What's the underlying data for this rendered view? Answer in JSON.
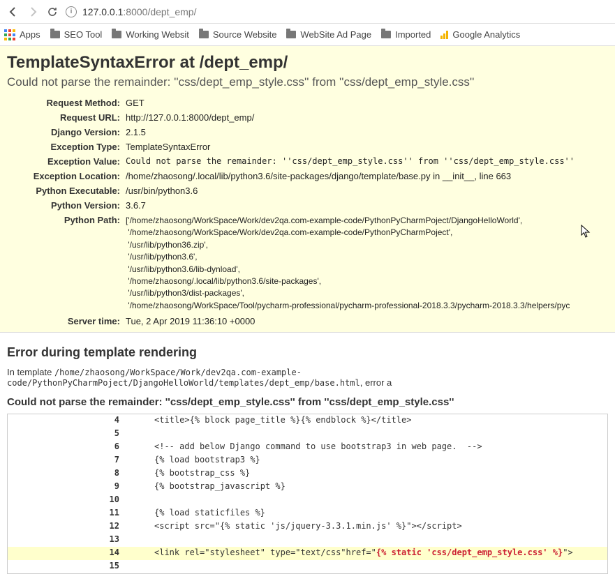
{
  "browser": {
    "url_host": "127.0.0.1",
    "url_port": ":8000",
    "url_path": "/dept_emp/",
    "bookmarks": [
      "Apps",
      "SEO Tool",
      "Working Websit",
      "Source Website",
      "WebSite Ad Page",
      "Imported",
      "Google Analytics"
    ]
  },
  "error": {
    "title": "TemplateSyntaxError at /dept_emp/",
    "subtitle": "Could not parse the remainder: ''css/dept_emp_style.css'' from ''css/dept_emp_style.css''",
    "kv": {
      "Request Method:": "GET",
      "Request URL:": "http://127.0.0.1:8000/dept_emp/",
      "Django Version:": "2.1.5",
      "Exception Type:": "TemplateSyntaxError",
      "Exception Value:": "Could not parse the remainder: ''css/dept_emp_style.css'' from ''css/dept_emp_style.css''",
      "Exception Location:": "/home/zhaosong/.local/lib/python3.6/site-packages/django/template/base.py in __init__, line 663",
      "Python Executable:": "/usr/bin/python3.6",
      "Python Version:": "3.6.7",
      "Python Path:": "['/home/zhaosong/WorkSpace/Work/dev2qa.com-example-code/PythonPyCharmPoject/DjangoHelloWorld',\n '/home/zhaosong/WorkSpace/Work/dev2qa.com-example-code/PythonPyCharmPoject',\n '/usr/lib/python36.zip',\n '/usr/lib/python3.6',\n '/usr/lib/python3.6/lib-dynload',\n '/home/zhaosong/.local/lib/python3.6/site-packages',\n '/usr/lib/python3/dist-packages',\n '/home/zhaosong/WorkSpace/Tool/pycharm-professional/pycharm-professional-2018.3.3/pycharm-2018.3.3/helpers/pyc",
      "Server time:": "Tue, 2 Apr 2019 11:36:10 +0000"
    }
  },
  "render": {
    "heading": "Error during template rendering",
    "in_template_prefix": "In template ",
    "template_path": "/home/zhaosong/WorkSpace/Work/dev2qa.com-example-code/PythonPyCharmPoject/DjangoHelloWorld/templates/dept_emp/base.html",
    "in_template_suffix": ", error a",
    "subheading": "Could not parse the remainder: ''css/dept_emp_style.css'' from ''css/dept_emp_style.css''",
    "lines": [
      {
        "n": 4,
        "t": "<title>{% block page_title %}{% endblock %}</title>"
      },
      {
        "n": 5,
        "t": ""
      },
      {
        "n": 6,
        "t": "<!-- add below Django command to use bootstrap3 in web page.  -->"
      },
      {
        "n": 7,
        "t": "{% load bootstrap3 %}"
      },
      {
        "n": 8,
        "t": "{% bootstrap_css %}"
      },
      {
        "n": 9,
        "t": "{% bootstrap_javascript %}"
      },
      {
        "n": 10,
        "t": ""
      },
      {
        "n": 11,
        "t": "{% load staticfiles %}"
      },
      {
        "n": 12,
        "t": "<script src=\"{% static 'js/jquery-3.3.1.min.js' %}\"></script>"
      },
      {
        "n": 13,
        "t": ""
      },
      {
        "n": 14,
        "t": "<link rel=\"stylesheet\" type=\"text/css\"href=\"",
        "err": "{% static 'css/dept_emp_style.css' %}",
        "t2": "\">",
        "hl": true
      },
      {
        "n": 15,
        "t": ""
      }
    ]
  }
}
